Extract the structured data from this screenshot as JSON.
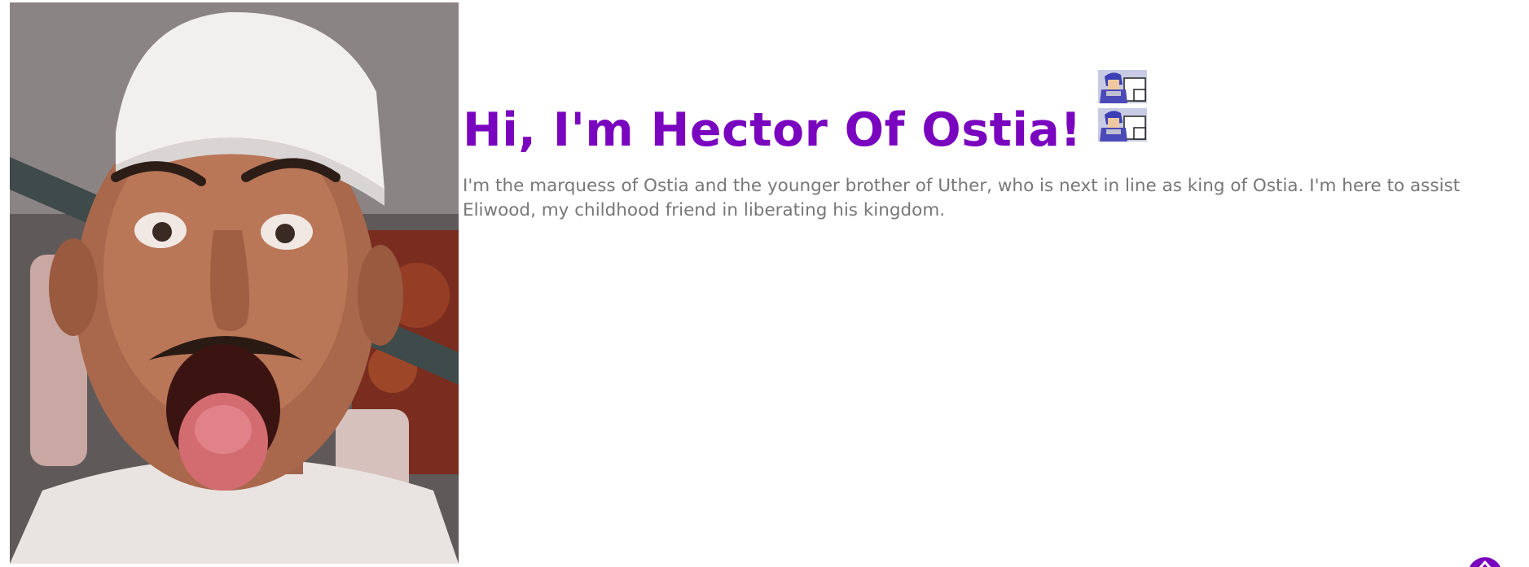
{
  "header": {
    "headline": "Hi, I'm Hector Of Ostia!"
  },
  "about": {
    "bio": "I'm the marquess of Ostia and the younger brother of Uther, who is next in line as king of Ostia. I'm here to assist Eliwood, my childhood friend in liberating his kingdom."
  },
  "images": {
    "portrait": "profile-photo",
    "sprite": "hector-pixel-sprite"
  },
  "colors": {
    "accent": "#7a05bf",
    "body_text": "#777777",
    "background": "#ffffff"
  },
  "icons": {
    "scroll_top": "arrow-up-icon"
  }
}
